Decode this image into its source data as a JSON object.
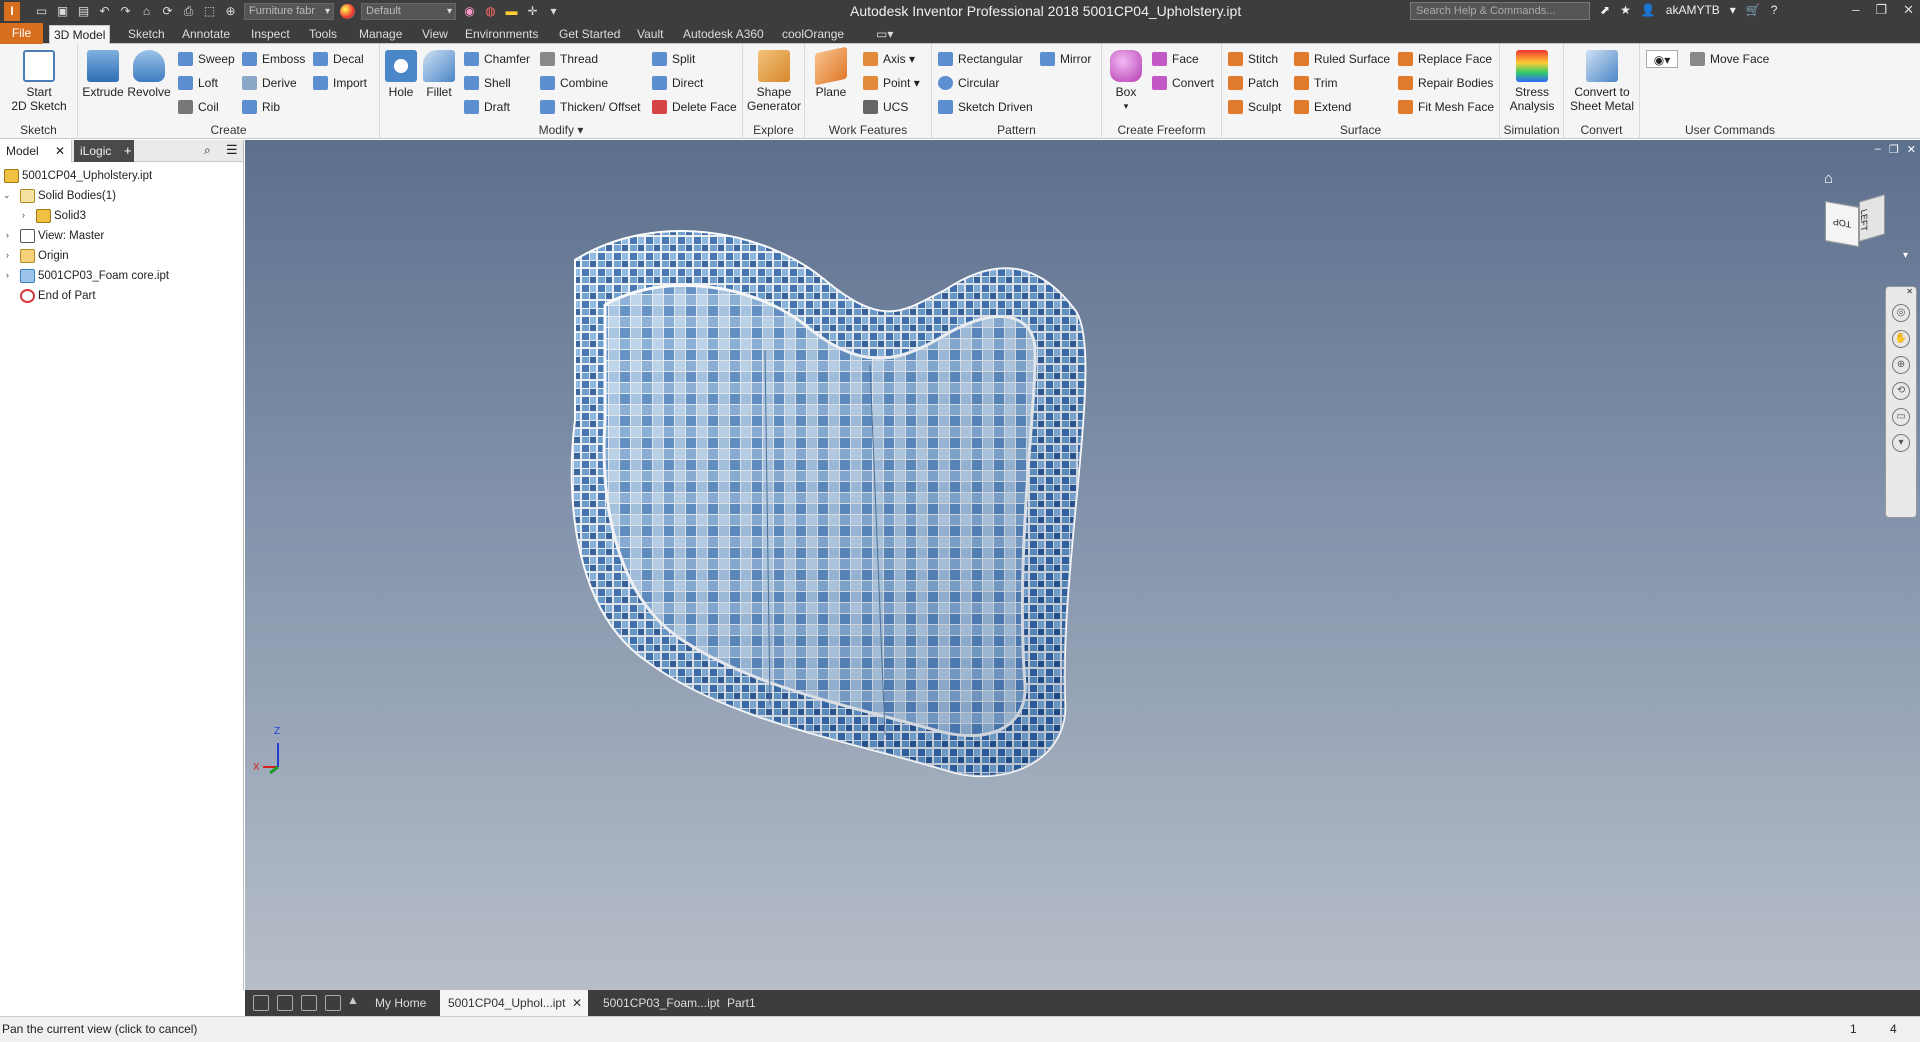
{
  "app": {
    "logo_letter": "I",
    "title": "Autodesk Inventor Professional 2018    5001CP04_Upholstery.ipt",
    "search_placeholder": "Search Help & Commands...",
    "user": "akAMYTB",
    "material_combo": "Furniture fabr",
    "appearance_combo": "Default"
  },
  "menu_tabs": [
    "File",
    "3D Model",
    "Sketch",
    "Annotate",
    "Inspect",
    "Tools",
    "Manage",
    "View",
    "Environments",
    "Get Started",
    "Vault",
    "Autodesk A360",
    "coolOrange"
  ],
  "active_menu_tab": "3D Model",
  "ribbon": {
    "sketch": {
      "label": "Sketch",
      "start_sketch": "Start\n2D Sketch"
    },
    "create": {
      "label": "Create",
      "extrude": "Extrude",
      "revolve": "Revolve",
      "sweep": "Sweep",
      "loft": "Loft",
      "coil": "Coil",
      "emboss": "Emboss",
      "derive": "Derive",
      "rib": "Rib",
      "decal": "Decal",
      "import": "Import"
    },
    "modify": {
      "label": "Modify",
      "hole": "Hole",
      "fillet": "Fillet",
      "chamfer": "Chamfer",
      "shell": "Shell",
      "draft": "Draft",
      "thread": "Thread",
      "combine": "Combine",
      "thicken_offset": "Thicken/ Offset",
      "split": "Split",
      "direct": "Direct",
      "delete_face": "Delete Face"
    },
    "explore": {
      "label": "Explore",
      "shape_generator": "Shape\nGenerator"
    },
    "work_features": {
      "label": "Work Features",
      "plane": "Plane",
      "axis": "Axis",
      "point": "Point",
      "ucs": "UCS"
    },
    "pattern": {
      "label": "Pattern",
      "rectangular": "Rectangular",
      "circular": "Circular",
      "sketch_driven": "Sketch Driven",
      "mirror": "Mirror"
    },
    "create_freeform": {
      "label": "Create Freeform",
      "box": "Box",
      "face": "Face",
      "convert": "Convert"
    },
    "surface": {
      "label": "Surface",
      "stitch": "Stitch",
      "patch": "Patch",
      "sculpt": "Sculpt",
      "ruled_surface": "Ruled Surface",
      "trim": "Trim",
      "extend": "Extend",
      "replace_face": "Replace Face",
      "repair_bodies": "Repair Bodies",
      "fit_mesh_face": "Fit Mesh Face"
    },
    "simulation": {
      "label": "Simulation",
      "stress_analysis": "Stress\nAnalysis"
    },
    "convert": {
      "label": "Convert",
      "sheet_metal": "Convert to\nSheet Metal"
    },
    "user_commands": {
      "label": "User Commands",
      "move_face": "Move Face"
    }
  },
  "browser": {
    "tabs": [
      "Model",
      "iLogic"
    ],
    "tree": [
      {
        "label": "5001CP04_Upholstery.ipt",
        "icon": "part-icon",
        "level": 0,
        "toggle": ""
      },
      {
        "label": "Solid Bodies(1)",
        "icon": "solid-bodies-icon",
        "level": 0,
        "toggle": "open"
      },
      {
        "label": "Solid3",
        "icon": "solid-icon",
        "level": 1,
        "toggle": "closed"
      },
      {
        "label": "View: Master",
        "icon": "view-icon",
        "level": 0,
        "toggle": "closed"
      },
      {
        "label": "Origin",
        "icon": "folder-icon",
        "level": 0,
        "toggle": "closed"
      },
      {
        "label": "5001CP03_Foam core.ipt",
        "icon": "derived-part-icon",
        "level": 0,
        "toggle": "closed"
      },
      {
        "label": "End of Part",
        "icon": "end-of-part-icon",
        "level": 0,
        "toggle": ""
      }
    ]
  },
  "viewcube": {
    "top": "TOP",
    "left": "LEFT"
  },
  "axis_labels": {
    "z": "Z",
    "x": "X"
  },
  "document_tabs": [
    "My Home",
    "5001CP04_Uphol...ipt",
    "5001CP03_Foam...ipt",
    "Part1"
  ],
  "active_document_tab": "5001CP04_Uphol...ipt",
  "status": {
    "message": "Pan the current view (click to cancel)",
    "count_a": "1",
    "count_b": "4"
  },
  "colors": {
    "accent": "#d86f1f",
    "titlebar": "#3d3d3d",
    "tile_dark": "#1f4f8f",
    "tile_light": "#b9d3ea"
  }
}
